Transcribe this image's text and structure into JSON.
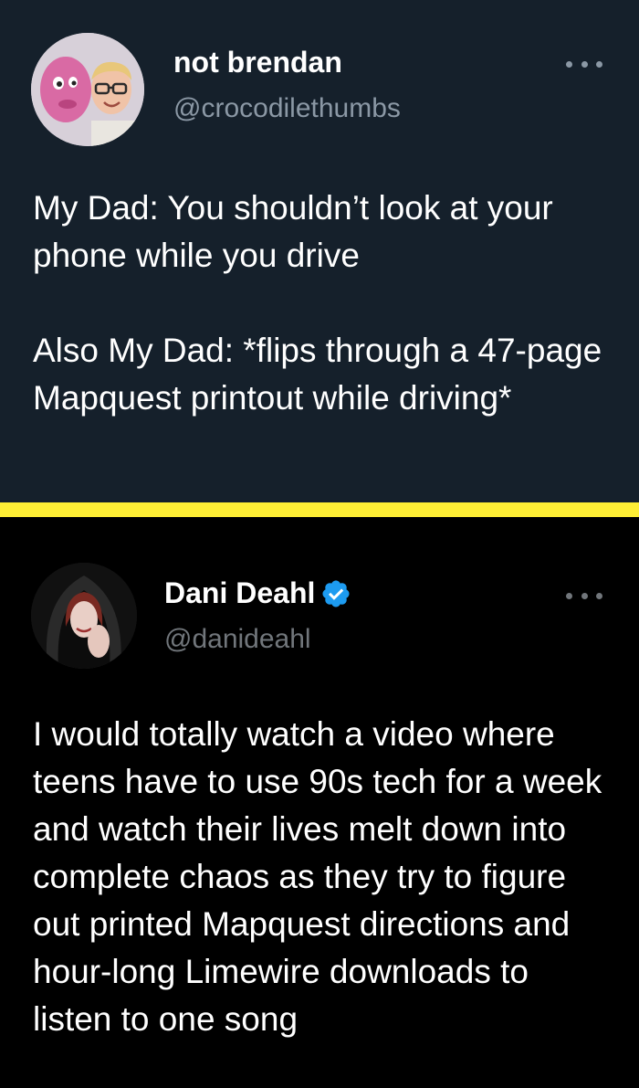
{
  "tweets": [
    {
      "author_name": "not brendan",
      "author_handle": "@crocodilethumbs",
      "avatar_icon": "profile-photo-with-pink-mascot",
      "more_icon": "more-options-icon",
      "paragraphs": [
        "My Dad: You shouldn’t look at your phone while you drive",
        "Also My Dad: *flips through a 47-page Mapquest printout while driving*"
      ]
    },
    {
      "author_name": "Dani Deahl",
      "author_handle": "@danideahl",
      "avatar_icon": "profile-photo-hooded-woman",
      "verified_icon": "verified-badge-icon",
      "more_icon": "more-options-icon",
      "paragraphs": [
        "I would totally watch a video where teens have to use 90s tech for a week and watch their lives melt down into complete chaos as they try to figure out printed Mapquest directions and hour-long Limewire downloads to listen to one song"
      ]
    }
  ],
  "colors": {
    "tweet1_background": "#15202b",
    "tweet2_background": "#000000",
    "divider": "#ffef35",
    "verified_blue": "#1d9bf0",
    "handle_gray": "#8b98a5"
  }
}
